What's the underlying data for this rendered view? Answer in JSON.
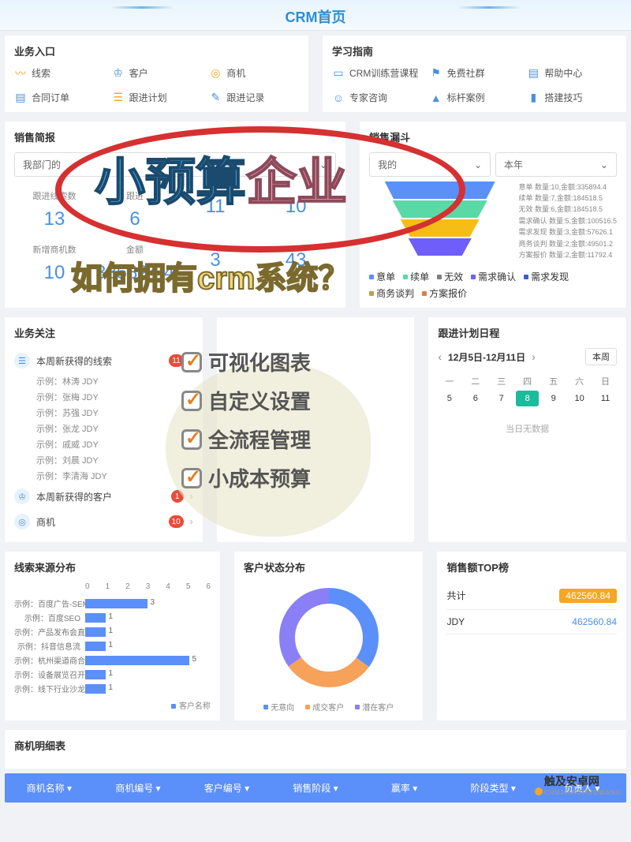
{
  "header": {
    "title": "CRM首页"
  },
  "biz_entry": {
    "title": "业务入口",
    "items": [
      {
        "label": "线索",
        "icon": "〰"
      },
      {
        "label": "客户",
        "icon": "♔"
      },
      {
        "label": "商机",
        "icon": "◎"
      },
      {
        "label": "合同订单",
        "icon": "▤"
      },
      {
        "label": "跟进计划",
        "icon": "☰"
      },
      {
        "label": "跟进记录",
        "icon": "✎"
      }
    ]
  },
  "guide": {
    "title": "学习指南",
    "items": [
      {
        "label": "CRM训练营课程",
        "icon": "▭"
      },
      {
        "label": "免费社群",
        "icon": "⚑"
      },
      {
        "label": "帮助中心",
        "icon": "▤"
      },
      {
        "label": "专家咨询",
        "icon": "☺"
      },
      {
        "label": "标杆案例",
        "icon": "▲"
      },
      {
        "label": "搭建技巧",
        "icon": "▮"
      }
    ]
  },
  "sales_brief": {
    "title": "销售简报",
    "filter": "我部门的",
    "stats_row1": [
      {
        "label": "跟进线索数",
        "value": "13"
      },
      {
        "label": "跟进",
        "value": "6"
      },
      {
        "label": "",
        "value": "11"
      },
      {
        "label": "",
        "value": "10"
      }
    ],
    "stats_row2": [
      {
        "label": "新增商机数",
        "value": "10"
      },
      {
        "label": "金额",
        "value": "335894.4"
      },
      {
        "label": "",
        "value": "3"
      },
      {
        "label": "",
        "value": "43"
      }
    ]
  },
  "funnel": {
    "title": "销售漏斗",
    "filter1": "我的",
    "filter2": "本年",
    "items": [
      {
        "label": "意单 数量:10,金额:335894.4"
      },
      {
        "label": "续单 数量:7,金额:184518.5"
      },
      {
        "label": "无效 数量:6,金额:184518.5"
      },
      {
        "label": "需求确认 数量:5,金额:100516.5"
      },
      {
        "label": "需求发现 数量:3,金额:57626.1"
      },
      {
        "label": "商务谈判 数量:2,金额:49501.2"
      },
      {
        "label": "方案报价 数量:2,金额:11792.4"
      }
    ],
    "legend": [
      "意单",
      "续单",
      "无效",
      "需求确认",
      "需求发现",
      "商务谈判",
      "方案报价"
    ]
  },
  "focus": {
    "title": "业务关注",
    "groups": [
      {
        "icon": "☰",
        "title": "本周新获得的线索",
        "badge": "11",
        "subs": [
          "示例：林涛  JDY",
          "示例：张梅  JDY",
          "示例：苏强  JDY",
          "示例：张龙  JDY",
          "示例：戚威  JDY",
          "示例：刘晨  JDY",
          "示例：李清海  JDY"
        ]
      },
      {
        "icon": "♔",
        "title": "本周新获得的客户",
        "badge": "1"
      },
      {
        "icon": "◎",
        "title": "商机",
        "badge": "10"
      }
    ]
  },
  "schedule": {
    "title": "跟进计划日程",
    "range": "12月5日-12月11日",
    "this_week": "本周",
    "day_headers": [
      "一",
      "二",
      "三",
      "四",
      "五",
      "六",
      "日"
    ],
    "days": [
      "5",
      "6",
      "7",
      "8",
      "9",
      "10",
      "11"
    ],
    "active_day": "8",
    "empty": "当日无数据"
  },
  "lead_source": {
    "title": "线索来源分布",
    "axis": [
      "0",
      "1",
      "2",
      "3",
      "4",
      "5",
      "6"
    ],
    "legend": "客户名称"
  },
  "chart_data": [
    {
      "type": "bar",
      "title": "线索来源分布",
      "xlabel": "",
      "ylabel": "",
      "xlim": [
        0,
        6
      ],
      "categories": [
        "示例：百度广告-SEM",
        "示例：百度SEO",
        "示例：产品发布会直播",
        "示例：抖音信息流",
        "示例：杭州渠道商合作",
        "示例：设备展览召开会",
        "示例：线下行业沙龙"
      ],
      "values": [
        3,
        1,
        1,
        1,
        5,
        1,
        1
      ]
    },
    {
      "type": "pie",
      "title": "客户状态分布",
      "series": [
        {
          "name": "无意向",
          "value": 35,
          "color": "#5b8ff9"
        },
        {
          "name": "成交客户",
          "value": 30,
          "color": "#f6a25b"
        },
        {
          "name": "潜在客户",
          "value": 35,
          "color": "#8b7ff5"
        }
      ]
    }
  ],
  "customer_status": {
    "title": "客户状态分布",
    "legend": [
      "无意向",
      "成交客户",
      "潜在客户"
    ]
  },
  "top_sales": {
    "title": "销售额TOP榜",
    "rows": [
      {
        "label": "共计",
        "value": "462560.84",
        "hl": true
      },
      {
        "label": "JDY",
        "value": "462560.84",
        "hl": false
      }
    ]
  },
  "detail": {
    "title": "商机明细表",
    "headers": [
      "商机名称",
      "商机编号",
      "客户编号",
      "销售阶段",
      "赢率",
      "阶段类型",
      "负责人"
    ]
  },
  "watermark": {
    "name": "触及安卓网",
    "sub": "CHUJIANZHUOWANG"
  },
  "overlay": {
    "title1_a": "小预算",
    "title1_b": "企业",
    "title2": "如何拥有crm系统？",
    "checks": [
      "可视化图表",
      "自定义设置",
      "全流程管理",
      "小成本预算"
    ]
  }
}
